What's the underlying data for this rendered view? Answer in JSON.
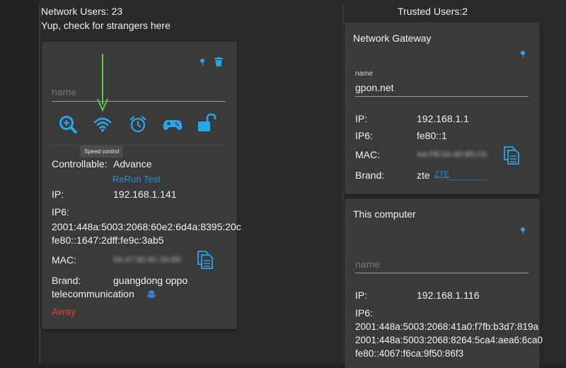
{
  "header": {
    "network_users": "Network Users: 23",
    "subtitle": "Yup, check for strangers here",
    "trusted_users": "Trusted Users:2"
  },
  "device_card": {
    "name_placeholder": "name",
    "actions": [
      {
        "icon": "zoom-in-icon"
      },
      {
        "icon": "wifi-icon"
      },
      {
        "icon": "alarm-clock-icon"
      },
      {
        "icon": "gamepad-icon"
      },
      {
        "icon": "unlock-icon"
      }
    ],
    "tooltip": "Speed control",
    "controllable_label": "Controllable:",
    "controllable_value": "Advance",
    "rerun_link": "ReRun Test",
    "ip_label": "IP:",
    "ip_value": "192.168.1.141",
    "ip6_label": "IP6:",
    "ip6_values": [
      "2001:448a:5003:2068:60e2:6d4a:8395:20c",
      "fe80::1647:2dff:fe9c:3ab5"
    ],
    "mac_label": "MAC:",
    "mac_value": "5A:47:3D:9C:3A:B5",
    "brand_label": "Brand:",
    "brand_value_line1": "guangdong oppo",
    "brand_value_line2": "telecommunication",
    "status": "Away"
  },
  "gateway_card": {
    "title": "Network Gateway",
    "name_label": "name",
    "name_value": "gpon.net",
    "ip_label": "IP:",
    "ip_value": "192.168.1.1",
    "ip6_label": "IP6:",
    "ip6_value": "fe80::1",
    "mac_label": "MAC:",
    "mac_value": "AA:FB:5A:4D:B5:C6",
    "brand_label": "Brand:",
    "brand_value": "zte",
    "brand_link": "ZTE"
  },
  "computer_card": {
    "title": "This computer",
    "name_placeholder": "name",
    "ip_label": "IP:",
    "ip_value": "192.168.1.116",
    "ip6_label": "IP6:",
    "ip6_values": [
      "2001:448a:5003:2068:41a0:f7fb:b3d7:819a",
      "2001:448a:5003:2068:8264:5ca4:aea6:6ca0",
      "fe80::4067:f6ca:9f50:86f3"
    ]
  },
  "colors": {
    "accent": "#29a6e8",
    "link": "#2a8fd0",
    "away": "#e0452f",
    "annotation_arrow": "#6cc04a",
    "card_bg": "#3a3a3b"
  }
}
